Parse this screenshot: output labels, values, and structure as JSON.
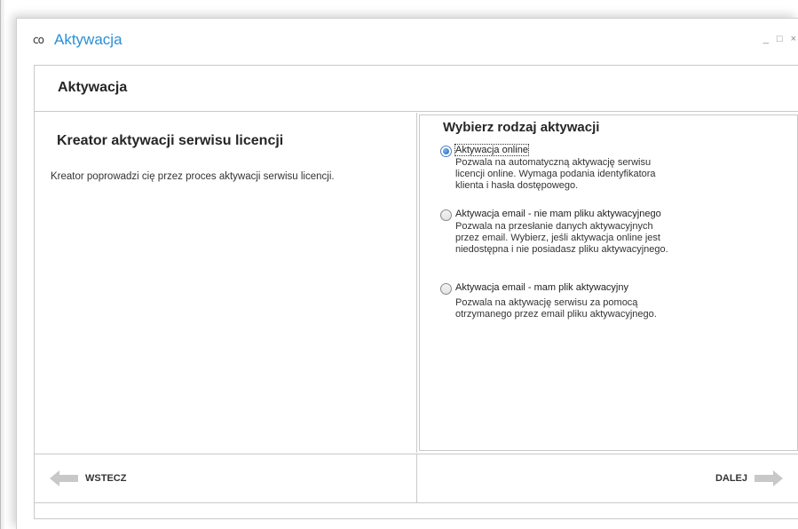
{
  "window": {
    "title": "Aktywacja",
    "app_icon": "co",
    "controls": {
      "minimize": "_",
      "maximize": "□",
      "close": "×"
    }
  },
  "header": {
    "title": "Aktywacja"
  },
  "left": {
    "title": "Kreator aktywacji serwisu licencji",
    "description": "Kreator poprowadzi cię przez proces aktywacji serwisu licencji."
  },
  "right": {
    "title": "Wybierz rodzaj aktywacji",
    "options": [
      {
        "label": "Aktywacja online",
        "lines": [
          "Pozwala na automatyczną aktywację serwisu",
          "licencji online. Wymaga podania identyfikatora",
          "klienta i hasła dostępowego."
        ],
        "selected": true
      },
      {
        "label": "Aktywacja email - nie mam pliku aktywacyjnego",
        "lines": [
          "Pozwala na przesłanie danych aktywacyjnych",
          "przez email. Wybierz, jeśli aktywacja online jest",
          "niedostępna i nie posiadasz pliku aktywacyjnego."
        ],
        "selected": false
      },
      {
        "label": "Aktywacja email - mam plik aktywacyjny",
        "lines": [
          "Pozwala na aktywację serwisu za pomocą",
          "otrzymanego przez email pliku aktywacyjnego."
        ],
        "selected": false
      }
    ]
  },
  "footer": {
    "back_label": "WSTECZ",
    "next_label": "DALEJ",
    "back_icon": "arrow-left-icon",
    "next_icon": "arrow-right-icon"
  },
  "colors": {
    "accent": "#2b8fd6",
    "border": "#c9c9c9",
    "arrow": "#c8c8c8"
  }
}
